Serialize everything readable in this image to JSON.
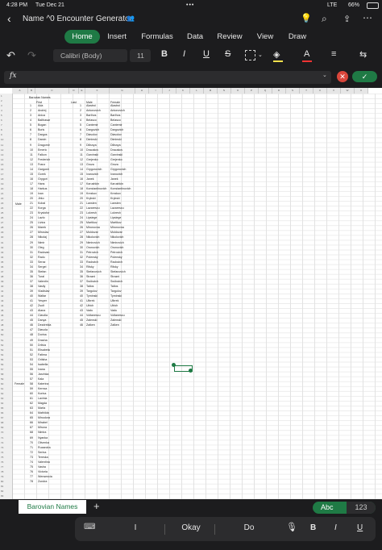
{
  "status": {
    "time": "4:28 PM",
    "date": "Tue Dec 21",
    "network": "LTE",
    "battery": "66%"
  },
  "title": "Name ^0 Encounter Generator",
  "tabs": [
    "Home",
    "Insert",
    "Formulas",
    "Data",
    "Review",
    "View",
    "Draw"
  ],
  "toolbar": {
    "font_name": "Calibri (Body)",
    "font_size": "11",
    "bold": "B",
    "italic": "I",
    "underline": "U",
    "strike": "S"
  },
  "formula": {
    "fx": "fx",
    "value": ""
  },
  "sheet": {
    "title_cell": "Barovian Names",
    "headers": {
      "first": "First",
      "last": "Last",
      "male": "Male",
      "female": "Female"
    },
    "gender_labels": {
      "male": "Male",
      "female": "Female"
    },
    "first_names": [
      "Ada",
      "Andrej",
      "Anica",
      "Balthasar",
      "Bogan",
      "Boris",
      "Dargos",
      "Darzin",
      "Dragomir",
      "Emeric",
      "Falkon",
      "Frederich",
      "Franz",
      "Gargosh",
      "Gorek",
      "Grygori",
      "Hans",
      "Harkus",
      "Ivan",
      "Jirko",
      "Kobal",
      "Korga",
      "Krystofor",
      "Lazlo",
      "Livius",
      "Marek",
      "Miroslav",
      "Nikolaj",
      "Nimir",
      "Oleg",
      "Radovan",
      "Radu",
      "Seraz",
      "Sergei",
      "Stefan",
      "Tural",
      "Valentin",
      "Vasily",
      "Vladislav",
      "Waltar",
      "Yesper",
      "Zsolt",
      "Alana",
      "Clavdia",
      "Danya",
      "Dezdrelda",
      "Diavola",
      "Dorina",
      "Drasha",
      "Drilvia",
      "Elisabeta",
      "Fatima",
      "Grilsha",
      "Isabella",
      "Ivana",
      "Jarzinka",
      "Kala",
      "Katerina",
      "Kereza",
      "Korina",
      "Lavinia",
      "Magda",
      "Marta",
      "Mathilda",
      "Minodora",
      "Mirabel",
      "Miruna",
      "Nimira",
      "Nyanka",
      "Olivenka",
      "Ruxandra",
      "Serina",
      "Tereska",
      "Valentina",
      "Vasha",
      "Victoria",
      "Wensencia",
      "Zondra"
    ],
    "male_numbers": [
      "1",
      "2",
      "3",
      "4",
      "5",
      "6",
      "7",
      "8",
      "9",
      "10",
      "11",
      "12",
      "13",
      "14",
      "15",
      "16",
      "17",
      "18",
      "19",
      "20",
      "21",
      "22",
      "23",
      "24",
      "25",
      "26",
      "27",
      "28",
      "29",
      "30",
      "31",
      "32",
      "33",
      "34",
      "35",
      "36",
      "37",
      "38",
      "39",
      "40",
      "41",
      "42",
      "43",
      "44",
      "45",
      "46"
    ],
    "last_names": [
      "Alastroi",
      "Antonovich",
      "Barthos",
      "Belasco",
      "Cantemir",
      "Dargovich",
      "Diavolov",
      "Diminski",
      "Dilisnya",
      "Dracakov",
      "Garvinski",
      "Grejenko",
      "Groza",
      "Grygorovich",
      "Ivanovich",
      "Janek",
      "Karushkin",
      "Konstantinovich",
      "Krezkov",
      "Krykski",
      "Lansten",
      "Lazarescu",
      "Lukresh",
      "Lipsiege",
      "Martikov",
      "Mironovna",
      "Moldovar",
      "Nikolovich",
      "Nimirovich",
      "Oronovich",
      "Petrovich",
      "Polensky",
      "Radovich",
      "Rilsky",
      "Stefanovich",
      "Strazni",
      "Swilovich",
      "Taltos",
      "Targolov",
      "Tyminski",
      "Ulbrek",
      "Ulrich",
      "Vadu",
      "Voltanescu",
      "Zalenski",
      "Zalken"
    ]
  },
  "sheet_tab": "Barovian Names",
  "add_sheet": "+",
  "input_mode": {
    "abc": "Abc",
    "num": "123"
  },
  "keyboard": {
    "suggestions": [
      "I",
      "Okay",
      "Do"
    ],
    "bold": "B",
    "italic": "I",
    "underline": "U"
  }
}
